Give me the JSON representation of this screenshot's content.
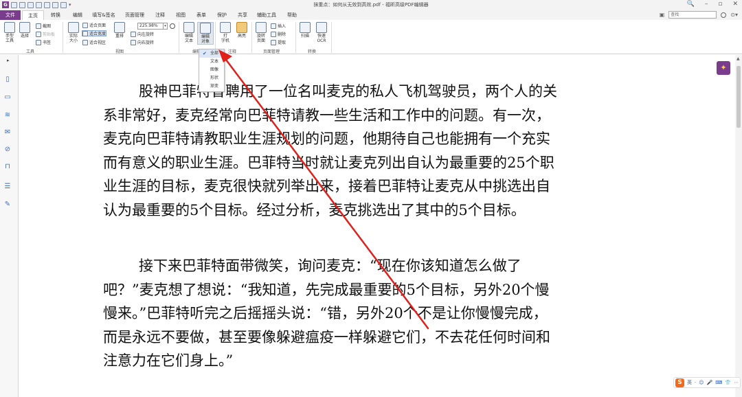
{
  "window": {
    "title": "抹重点：如何从无效到高效.pdf - 福昕高级PDF编辑器",
    "controls": [
      "🔍",
      "–",
      "▫",
      "✕"
    ]
  },
  "quick_access": {
    "logo": "G",
    "dropdown": "▾"
  },
  "menu": {
    "tabs": [
      "文件",
      "主页",
      "转换",
      "编辑",
      "填写&签名",
      "页面管理",
      "注释",
      "视图",
      "表单",
      "保护",
      "共享",
      "辅助工具",
      "帮助"
    ],
    "active": "主页"
  },
  "search": {
    "placeholder": "查找",
    "extra": "⊙▾"
  },
  "ribbon": {
    "tools": {
      "hand": "手型\n工具",
      "select": "选择",
      "screenshot": "截图",
      "clipboard": "剪贴板",
      "bookmark": "书签",
      "group": "工具"
    },
    "view": {
      "actual_size": "实际\n大小",
      "fit_page": "适合页面",
      "fit_width": "适合宽度",
      "fit_visible": "适合视区",
      "reflow": "重排",
      "zoom": "225.98%",
      "rotate_left": "向左旋转",
      "rotate_right": "向右旋转",
      "group": "视图"
    },
    "edit": {
      "edit_text": "编辑\n文本",
      "edit_object": "编辑\n对象",
      "group": "编辑"
    },
    "comment": {
      "typewriter": "打\n字机",
      "highlight": "高亮",
      "group": "注释"
    },
    "pages": {
      "rotate_page": "旋转\n页面",
      "insert": "插入",
      "delete": "删除",
      "extract": "提取",
      "group": "页面管理"
    },
    "convert": {
      "scan": "扫描",
      "quick_ocr": "快速\nOCR",
      "group": "转换"
    }
  },
  "edit_object_menu": {
    "items": [
      "全部",
      "文本",
      "图像",
      "形状",
      "渐变"
    ],
    "checked": "全部"
  },
  "document": {
    "paragraph1": [
      "股神巴菲特曾聘用了一位名叫麦克的私人飞机驾驶员，两个人的关",
      "系非常好，麦克经常向巴菲特请教一些生活和工作中的问题。有一次，",
      "麦克向巴菲特请教职业生涯规划的问题，他期待自己也能拥有一个充实",
      "而有意义的职业生涯。巴菲特当时就让麦克列出自认为最重要的25个职",
      "业生涯的目标，麦克很快就列举出来，接着巴菲特让麦克从中挑选出自",
      "认为最重要的5个目标。经过分析，麦克挑选出了其中的5个目标。"
    ],
    "paragraph2": [
      "接下来巴菲特面带微笑，询问麦克：“现在你该知道怎么做了",
      "吧？”麦克想了想说：“我知道，先完成最重要的5个目标，另外20个慢",
      "慢来。”巴菲特听完之后摇摇头说：“错，另外20个不是让你慢慢完成，",
      "而是永远不要做，甚至要像躲避瘟疫一样躲避它们，不去花任何时间和",
      "注意力在它们身上。”"
    ]
  },
  "ime": {
    "logo": "S",
    "items": [
      "英",
      "·",
      "☺",
      "🎤",
      "⌨",
      "👕",
      "⋯"
    ]
  },
  "colors": {
    "brand": "#7a3d8e",
    "arrow": "#e0201b",
    "highlight": "#f0c97a"
  }
}
